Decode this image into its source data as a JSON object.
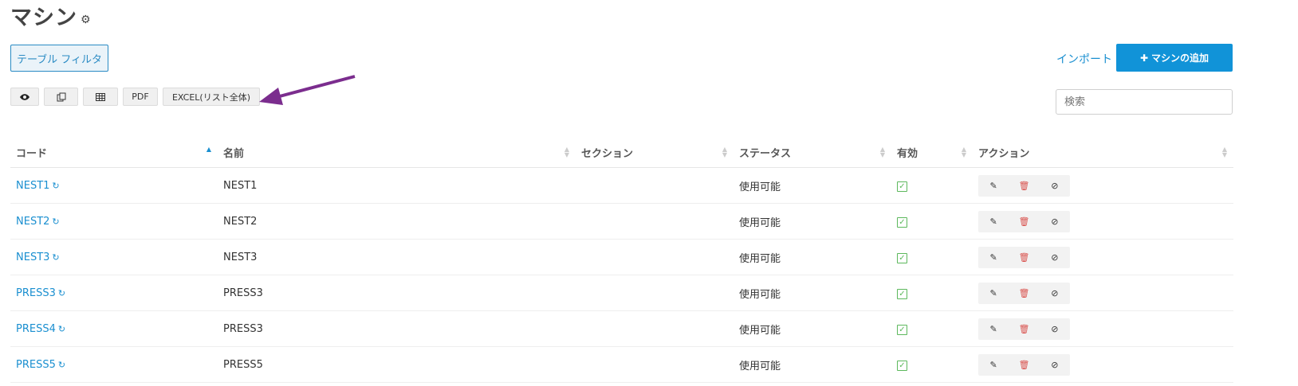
{
  "header": {
    "title": "マシン",
    "filter_label": "テーブル フィルタ",
    "import_label": "インポート",
    "add_label": "マシンの追加"
  },
  "toolbar": {
    "view_icon": "eye-icon",
    "copy_icon": "copy-icon",
    "table_icon": "table-icon",
    "pdf_label": "PDF",
    "excel_label": "EXCEL(リスト全体)"
  },
  "search": {
    "placeholder": "検索"
  },
  "table": {
    "columns": [
      "コード",
      "名前",
      "セクション",
      "ステータス",
      "有効",
      "アクション"
    ],
    "rows": [
      {
        "code": "NEST1",
        "name": "NEST1",
        "section": "",
        "status": "使用可能",
        "enabled": true
      },
      {
        "code": "NEST2",
        "name": "NEST2",
        "section": "",
        "status": "使用可能",
        "enabled": true
      },
      {
        "code": "NEST3",
        "name": "NEST3",
        "section": "",
        "status": "使用可能",
        "enabled": true
      },
      {
        "code": "PRESS3",
        "name": "PRESS3",
        "section": "",
        "status": "使用可能",
        "enabled": true
      },
      {
        "code": "PRESS4",
        "name": "PRESS3",
        "section": "",
        "status": "使用可能",
        "enabled": true
      },
      {
        "code": "PRESS5",
        "name": "PRESS5",
        "section": "",
        "status": "使用可能",
        "enabled": true
      }
    ]
  },
  "colors": {
    "accent": "#1193d8",
    "link": "#1a8fd0",
    "arrow": "#7b2d8e",
    "check": "#5cb85c",
    "delete": "#d9534f"
  }
}
